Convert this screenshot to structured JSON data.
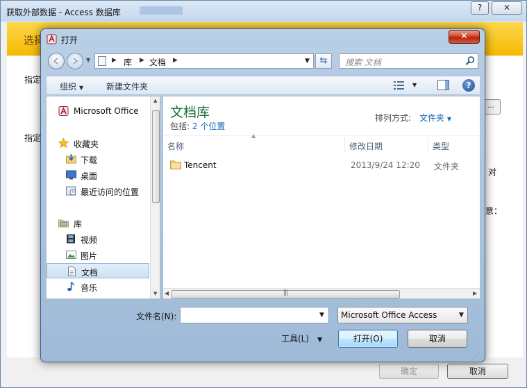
{
  "background_window": {
    "title": "获取外部数据 - Access 数据库",
    "help_label": "?",
    "close_label": "✕",
    "banner_text": "选择",
    "labels": [
      "指定",
      "指定",
      "对",
      "意："
    ],
    "browse_label": "...",
    "ok_label": "确定",
    "cancel_label": "取消"
  },
  "dialog": {
    "title": "打开",
    "close_label": "✕",
    "address": {
      "segments": [
        "库",
        "文档"
      ]
    },
    "search": {
      "placeholder": "搜索 文档"
    },
    "toolbar": {
      "organize": "组织",
      "new_folder": "新建文件夹"
    },
    "nav_pane": {
      "items": [
        {
          "label": "Microsoft Office",
          "icon": "access-icon",
          "group": true
        },
        {
          "label": "收藏夹",
          "icon": "star-icon",
          "group": true
        },
        {
          "label": "下载",
          "icon": "download-folder-icon"
        },
        {
          "label": "桌面",
          "icon": "desktop-icon"
        },
        {
          "label": "最近访问的位置",
          "icon": "recent-places-icon"
        },
        {
          "label": "库",
          "icon": "library-icon",
          "group": true
        },
        {
          "label": "视频",
          "icon": "video-icon"
        },
        {
          "label": "图片",
          "icon": "picture-icon"
        },
        {
          "label": "文档",
          "icon": "document-icon",
          "selected": true
        },
        {
          "label": "音乐",
          "icon": "music-icon"
        }
      ]
    },
    "content": {
      "library_title": "文档库",
      "includes_label": "包括:",
      "includes_link": "2 个位置",
      "arrange_label": "排列方式:",
      "arrange_value": "文件夹",
      "columns": [
        "名称",
        "修改日期",
        "类型"
      ],
      "rows": [
        {
          "name": "Tencent",
          "date": "2013/9/24 12:20",
          "type": "文件夹"
        }
      ]
    },
    "filename_label": "文件名(N):",
    "filename_value": "",
    "filetype_value": "Microsoft Office Access",
    "tools_label": "工具(L)",
    "open_label": "打开(O)",
    "cancel_label": "取消"
  },
  "colors": {
    "banner": "#f7b800",
    "library_title": "#1b6e3d",
    "link": "#1564b9",
    "dialog_frame": "#b9cfe6"
  }
}
